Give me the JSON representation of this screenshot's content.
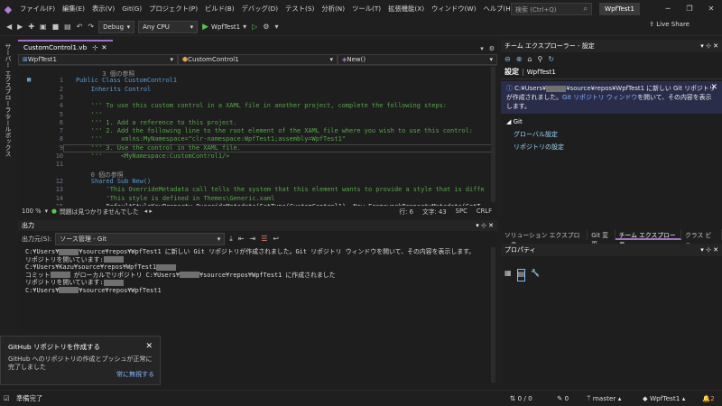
{
  "menu": {
    "items": [
      "ファイル(F)",
      "編集(E)",
      "表示(V)",
      "Git(G)",
      "プロジェクト(P)",
      "ビルド(B)",
      "デバッグ(D)",
      "テスト(S)",
      "分析(N)",
      "ツール(T)",
      "拡張機能(X)",
      "ウィンドウ(W)",
      "ヘルプ(H)"
    ],
    "search_placeholder": "検索 (Ctrl+Q)",
    "solution_name": "WpfTest1"
  },
  "toolbar": {
    "config": "Debug",
    "platform": "Any CPU",
    "run_target": "WpfTest1",
    "live_share": "Live Share"
  },
  "left_tabs": [
    "サーバー エクスプローラー",
    "ツールボックス"
  ],
  "editor": {
    "tab_label": "CustomControl1.vb",
    "nav_project": "WpfTest1",
    "nav_class": "CustomControl1",
    "nav_member": "New()",
    "status_zoom": "100 %",
    "status_issues": "問題は見つかりませんでした",
    "status_line": "行: 6",
    "status_col": "文字: 43",
    "status_spc": "SPC",
    "status_crlf": "CRLF",
    "lines": [
      {
        "n": "",
        "t": "3 個の参照",
        "c": "ref",
        "indent": "       "
      },
      {
        "n": "1",
        "t": "Public Class CustomControl1",
        "c": "kw",
        "indent": ""
      },
      {
        "n": "2",
        "t": "Inherits Control",
        "c": "kw",
        "indent": "    "
      },
      {
        "n": "3",
        "t": "",
        "c": "tx",
        "indent": ""
      },
      {
        "n": "4",
        "t": "''' To use this custom control in a XAML file in another project, complete the following steps:",
        "c": "cm",
        "indent": "    "
      },
      {
        "n": "5",
        "t": "'''",
        "c": "cm",
        "indent": "    "
      },
      {
        "n": "6",
        "t": "''' 1. Add a reference to this project.",
        "c": "cm",
        "indent": "    "
      },
      {
        "n": "7",
        "t": "''' 2. Add the following line to the root element of the XAML file where you wish to use this control:",
        "c": "cm",
        "indent": "    "
      },
      {
        "n": "8",
        "t": "'''     xmlns:MyNamespace=\"clr-namespace:WpfTest1;assembly=WpfTest1\"",
        "c": "cm",
        "indent": "    "
      },
      {
        "n": "9",
        "t": "''' 3. Use the control in the XAML file.",
        "c": "cm",
        "indent": "    "
      },
      {
        "n": "10",
        "t": "'''     <MyNamespace:CustomControl1/>",
        "c": "cm",
        "indent": "    "
      },
      {
        "n": "11",
        "t": "",
        "c": "tx",
        "indent": ""
      },
      {
        "n": "",
        "t": "0 個の参照",
        "c": "ref",
        "indent": "    "
      },
      {
        "n": "12",
        "t": "Shared Sub New()",
        "c": "kw",
        "indent": "    "
      },
      {
        "n": "13",
        "t": "'This OverrideMetadata call tells the system that this element wants to provide a style that is diffe",
        "c": "cm",
        "indent": "        "
      },
      {
        "n": "14",
        "t": "'This style is defined in Themes\\Generic.xaml",
        "c": "cm",
        "indent": "        "
      },
      {
        "n": "15",
        "t": "DefaultStyleKeyProperty.OverrideMetadata(GetType(CustomControl1), New FrameworkPropertyMetadata(GetT",
        "c": "tx",
        "indent": "        "
      }
    ]
  },
  "output": {
    "title": "出力",
    "source_label": "出力元(S):",
    "source_value": "ソース管理 - Git",
    "lines": [
      [
        "C:¥Users¥",
        "¥source¥repos¥WpfTest1 に新しい Git リポジトリが作成されました。Git リポジトリ ウィンドウを開いて、その内容を表示します。"
      ],
      [
        "リポジトリを開いています:",
        ""
      ],
      [
        "C:¥Users¥Kazu¥source¥repos¥WpfTest1",
        ""
      ],
      [
        "コミット",
        " がローカルでリポジトリ C:¥Users¥",
        "¥source¥repos¥WpfTest1 に作成されました"
      ],
      [
        "リポジトリを開いています:",
        ""
      ],
      [
        "C:¥Users¥",
        "¥source¥repos¥WpfTest1"
      ]
    ]
  },
  "team_explorer": {
    "title": "チーム エクスプローラー - 設定",
    "section": "設定",
    "section_sub": "WpfTest1",
    "info_pre": "C:¥Users¥",
    "info_post": "¥source¥repos¥WpfTest1 に新しい Git リポジトリが作成されました。",
    "info_link": "Git リポジトリ ウィンドウ",
    "info_tail": "を開いて、その内容を表示します。",
    "git_header": "Git",
    "links": [
      "グローバル設定",
      "リポジトリの設定"
    ]
  },
  "right_tabs": [
    "ソリューション エクスプローラー",
    "Git 変更",
    "チーム エクスプローラー",
    "クラス ビュー"
  ],
  "properties": {
    "title": "プロパティ"
  },
  "toast": {
    "title": "GitHub リポジトリを作成する",
    "body": "GitHub へのリポジトリの作成とプッシュが正常に完了しました",
    "link": "常に無視する"
  },
  "status": {
    "ready": "準備完了",
    "updown": "0 / 0",
    "pencil": "0",
    "branch": "master",
    "repo": "WpfTest1",
    "notif": "2"
  }
}
